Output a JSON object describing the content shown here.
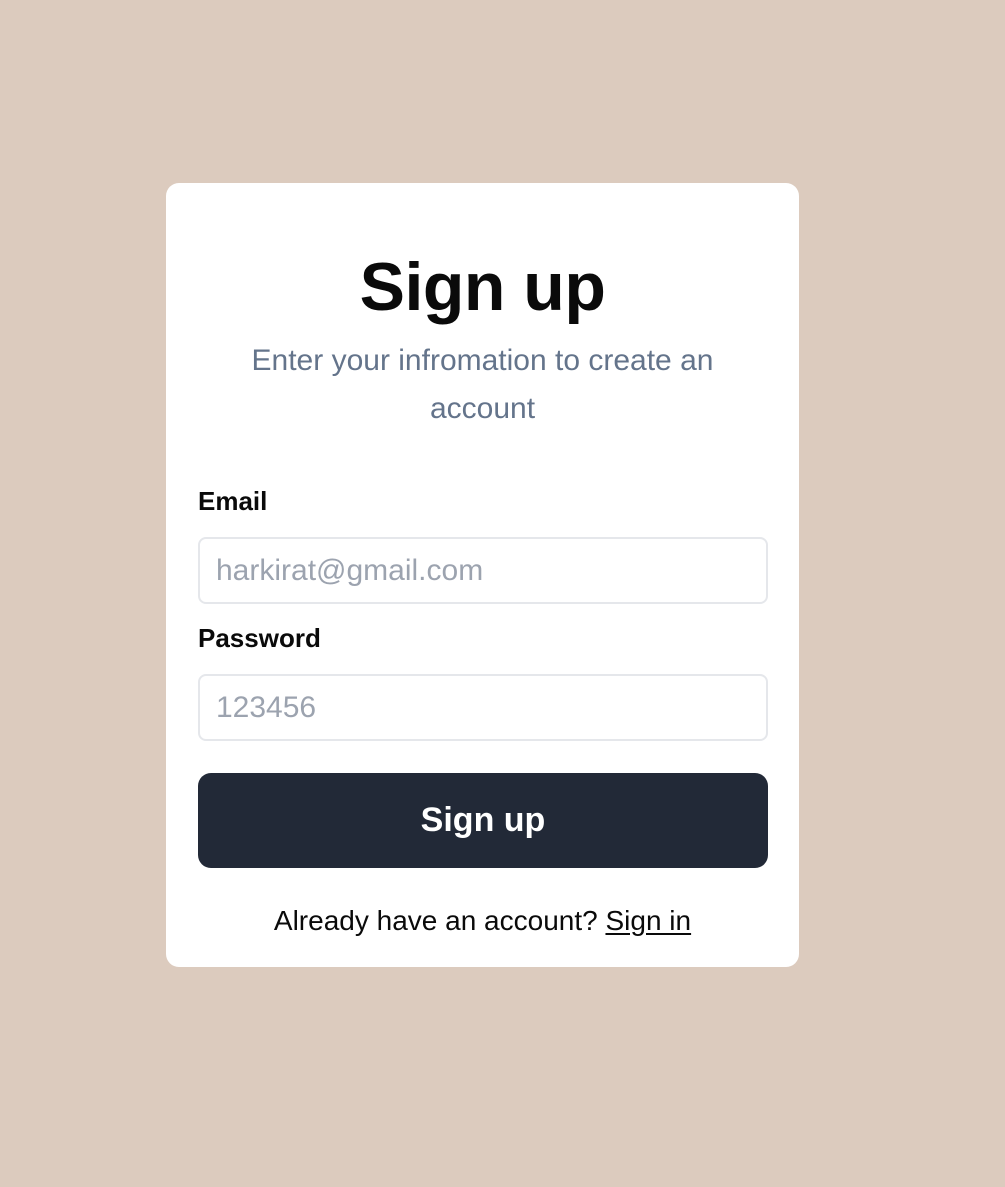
{
  "page": {
    "background_color": "#dccbbe"
  },
  "card": {
    "title": "Sign up",
    "subtitle": "Enter your infromation to create an account"
  },
  "form": {
    "email": {
      "label": "Email",
      "placeholder": "harkirat@gmail.com",
      "value": ""
    },
    "password": {
      "label": "Password",
      "placeholder": "123456",
      "value": ""
    },
    "submit_label": "Sign up",
    "submit_color": "#222937"
  },
  "footer": {
    "prompt": "Already have an account? ",
    "link_label": "Sign in"
  }
}
